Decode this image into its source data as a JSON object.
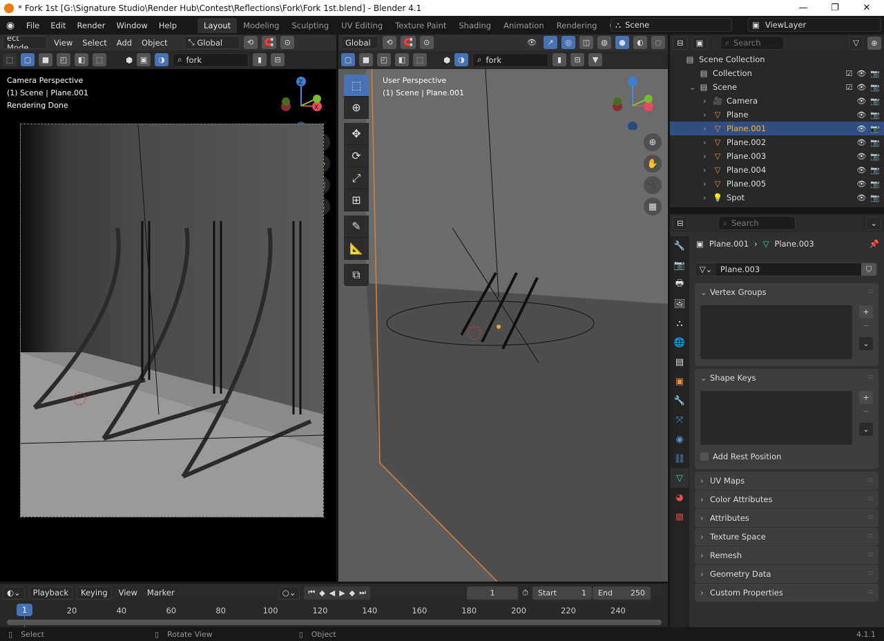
{
  "window": {
    "title": "* Fork 1st [G:\\Signature Studio\\Render Hub\\Contest\\Reflections\\Fork\\Fork 1st.blend] - Blender 4.1",
    "minimize": "—",
    "maximize": "❐",
    "close": "✕"
  },
  "menu": [
    "File",
    "Edit",
    "Render",
    "Window",
    "Help"
  ],
  "workspaces": [
    "Layout",
    "Modeling",
    "Sculpting",
    "UV Editing",
    "Texture Paint",
    "Shading",
    "Animation",
    "Rendering",
    "Compos"
  ],
  "scene": {
    "name": "Scene",
    "view_layer": "ViewLayer"
  },
  "left_view": {
    "mode": "ect Mode",
    "menus": [
      "View",
      "Select",
      "Add",
      "Object"
    ],
    "orientation": "Global",
    "search": "fork",
    "overlay": [
      "Camera Perspective",
      "(1) Scene | Plane.001",
      "Rendering Done"
    ]
  },
  "right_view": {
    "orientation": "Global",
    "search": "fork",
    "overlay": [
      "User Perspective",
      "(1) Scene | Plane.001"
    ]
  },
  "gizmo": {
    "x": "X",
    "y": "Y",
    "z": "Z"
  },
  "outliner": {
    "search_placeholder": "Search",
    "items": [
      {
        "label": "Scene Collection",
        "icon": "▤",
        "depth": 0
      },
      {
        "label": "Collection",
        "icon": "▤",
        "depth": 1
      },
      {
        "label": "Scene",
        "icon": "▤",
        "depth": 1,
        "expanded": true
      },
      {
        "label": "Camera",
        "icon": "🎥",
        "depth": 2
      },
      {
        "label": "Plane",
        "icon": "▽",
        "depth": 2
      },
      {
        "label": "Plane.001",
        "icon": "▽",
        "depth": 2,
        "selected": true
      },
      {
        "label": "Plane.002",
        "icon": "▽",
        "depth": 2
      },
      {
        "label": "Plane.003",
        "icon": "▽",
        "depth": 2
      },
      {
        "label": "Plane.004",
        "icon": "▽",
        "depth": 2
      },
      {
        "label": "Plane.005",
        "icon": "▽",
        "depth": 2
      },
      {
        "label": "Spot",
        "icon": "💡",
        "depth": 2
      }
    ]
  },
  "properties": {
    "search_placeholder": "Search",
    "breadcrumb": [
      "Plane.001",
      "Plane.003"
    ],
    "mesh_name": "Plane.003",
    "panels": [
      "Vertex Groups",
      "Shape Keys",
      "UV Maps",
      "Color Attributes",
      "Attributes",
      "Texture Space",
      "Remesh",
      "Geometry Data",
      "Custom Properties"
    ],
    "add_rest_position": "Add Rest Position"
  },
  "timeline": {
    "menus": [
      "Playback",
      "Keying",
      "View",
      "Marker"
    ],
    "current_frame": "1",
    "start_label": "Start",
    "start": "1",
    "end_label": "End",
    "end": "250",
    "ticks": [
      "20",
      "40",
      "60",
      "80",
      "100",
      "120",
      "140",
      "160",
      "180",
      "200",
      "220",
      "240"
    ],
    "playhead": "1"
  },
  "status": {
    "items": [
      "Select",
      "Rotate View",
      "Object"
    ],
    "version": "4.1.1"
  },
  "colors": {
    "accent": "#4772b3",
    "selection": "#334d80",
    "object_orange": "#e8933a",
    "mesh_green": "#3cd2a0"
  }
}
